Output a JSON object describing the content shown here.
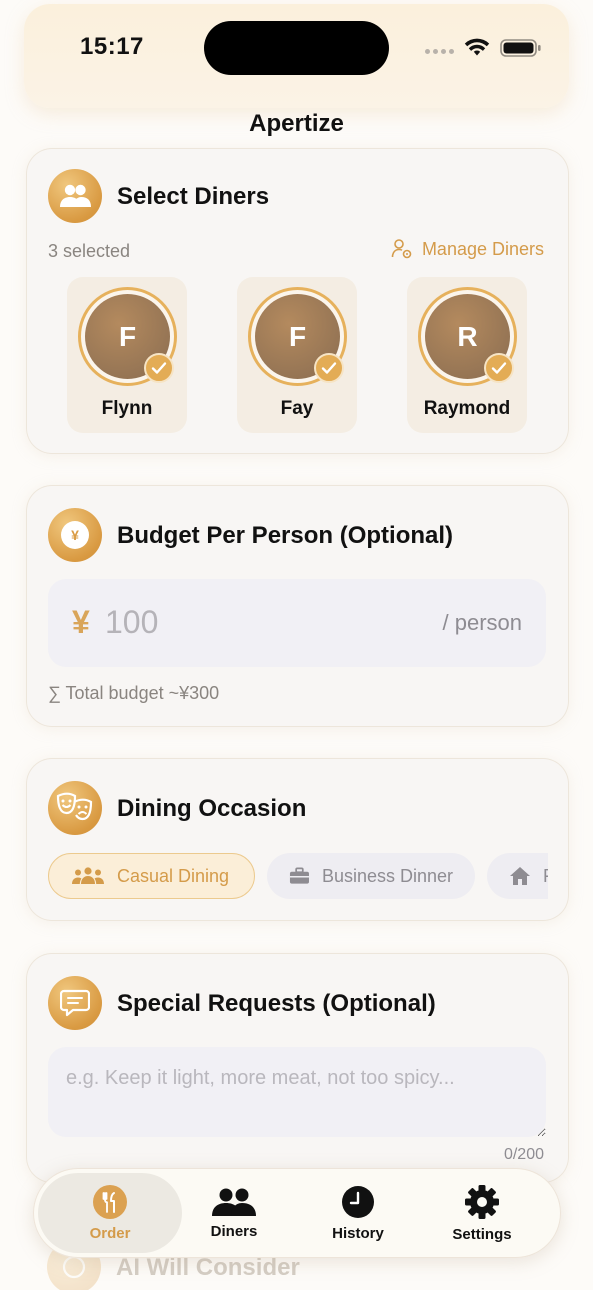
{
  "status_bar": {
    "time": "15:17"
  },
  "app": {
    "title": "Apertize"
  },
  "diners": {
    "title": "Select Diners",
    "selected_text": "3 selected",
    "manage_label": "Manage Diners",
    "items": [
      {
        "initial": "F",
        "name": "Flynn",
        "selected": true
      },
      {
        "initial": "F",
        "name": "Fay",
        "selected": true
      },
      {
        "initial": "R",
        "name": "Raymond",
        "selected": true
      }
    ]
  },
  "budget": {
    "title": "Budget Per Person (Optional)",
    "currency_symbol": "¥",
    "placeholder": "100",
    "unit": "/ person",
    "total": "∑ Total budget ~¥300"
  },
  "occasion": {
    "title": "Dining Occasion",
    "chips": [
      {
        "label": "Casual Dining",
        "icon": "group-icon",
        "active": true
      },
      {
        "label": "Business Dinner",
        "icon": "briefcase-icon",
        "active": false
      },
      {
        "label": "F",
        "icon": "house-icon",
        "active": false
      }
    ]
  },
  "requests": {
    "title": "Special Requests (Optional)",
    "placeholder": "e.g. Keep it light, more meat, not too spicy...",
    "counter": "0/200"
  },
  "next_section": {
    "title": "AI Will Consider"
  },
  "tabbar": {
    "tabs": [
      {
        "label": "Order",
        "icon": "fork-knife-icon",
        "active": true
      },
      {
        "label": "Diners",
        "icon": "people-icon",
        "active": false
      },
      {
        "label": "History",
        "icon": "clock-icon",
        "active": false
      },
      {
        "label": "Settings",
        "icon": "gear-icon",
        "active": false
      }
    ]
  },
  "colors": {
    "accent": "#d49b4a",
    "accent_dark": "#cf8d36",
    "avatar": "#9a7856",
    "input_bg": "#f1f0f5"
  }
}
